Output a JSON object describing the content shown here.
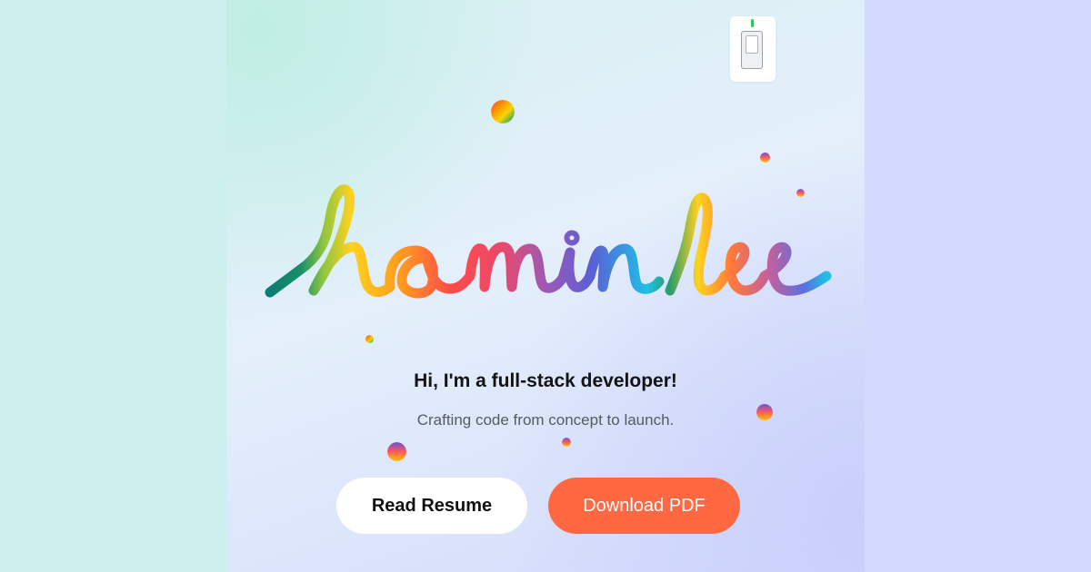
{
  "hero": {
    "signature_name": "hamin lee",
    "greeting": "Hi, I'm a full-stack developer!",
    "tagline": "Crafting code from concept to launch."
  },
  "buttons": {
    "read_resume": "Read Resume",
    "download_pdf": "Download PDF"
  },
  "theme_toggle": {
    "icon": "light-switch-icon",
    "state": "on"
  },
  "colors": {
    "left_panel": "#cdefed",
    "right_panel": "#d2d9fd",
    "primary_button": "#ff6840",
    "secondary_button": "#ffffff",
    "text_dark": "#141414",
    "text_muted": "#555b63",
    "switch_indicator": "#35c45a"
  }
}
